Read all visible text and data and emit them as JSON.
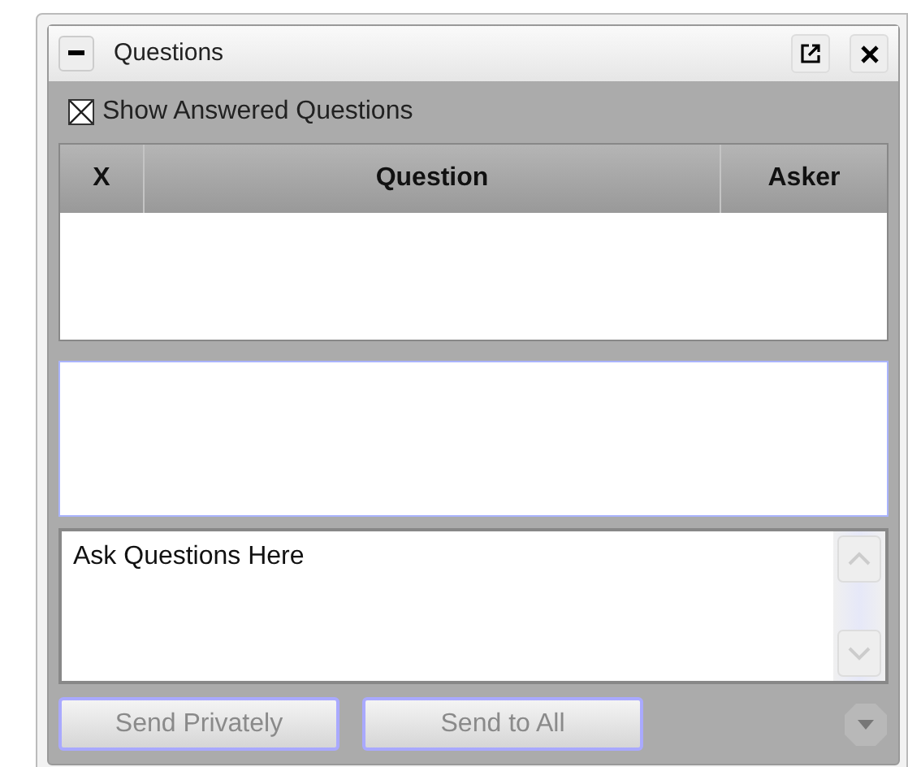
{
  "panel": {
    "title": "Questions"
  },
  "show_answered": {
    "label": "Show Answered Questions",
    "checked": true
  },
  "table": {
    "columns": [
      "X",
      "Question",
      "Asker"
    ]
  },
  "ask_field": {
    "value": "Ask Questions Here"
  },
  "buttons": [
    {
      "label": "Send Privately",
      "disabled": true
    },
    {
      "label": "Send to All",
      "disabled": true
    }
  ]
}
